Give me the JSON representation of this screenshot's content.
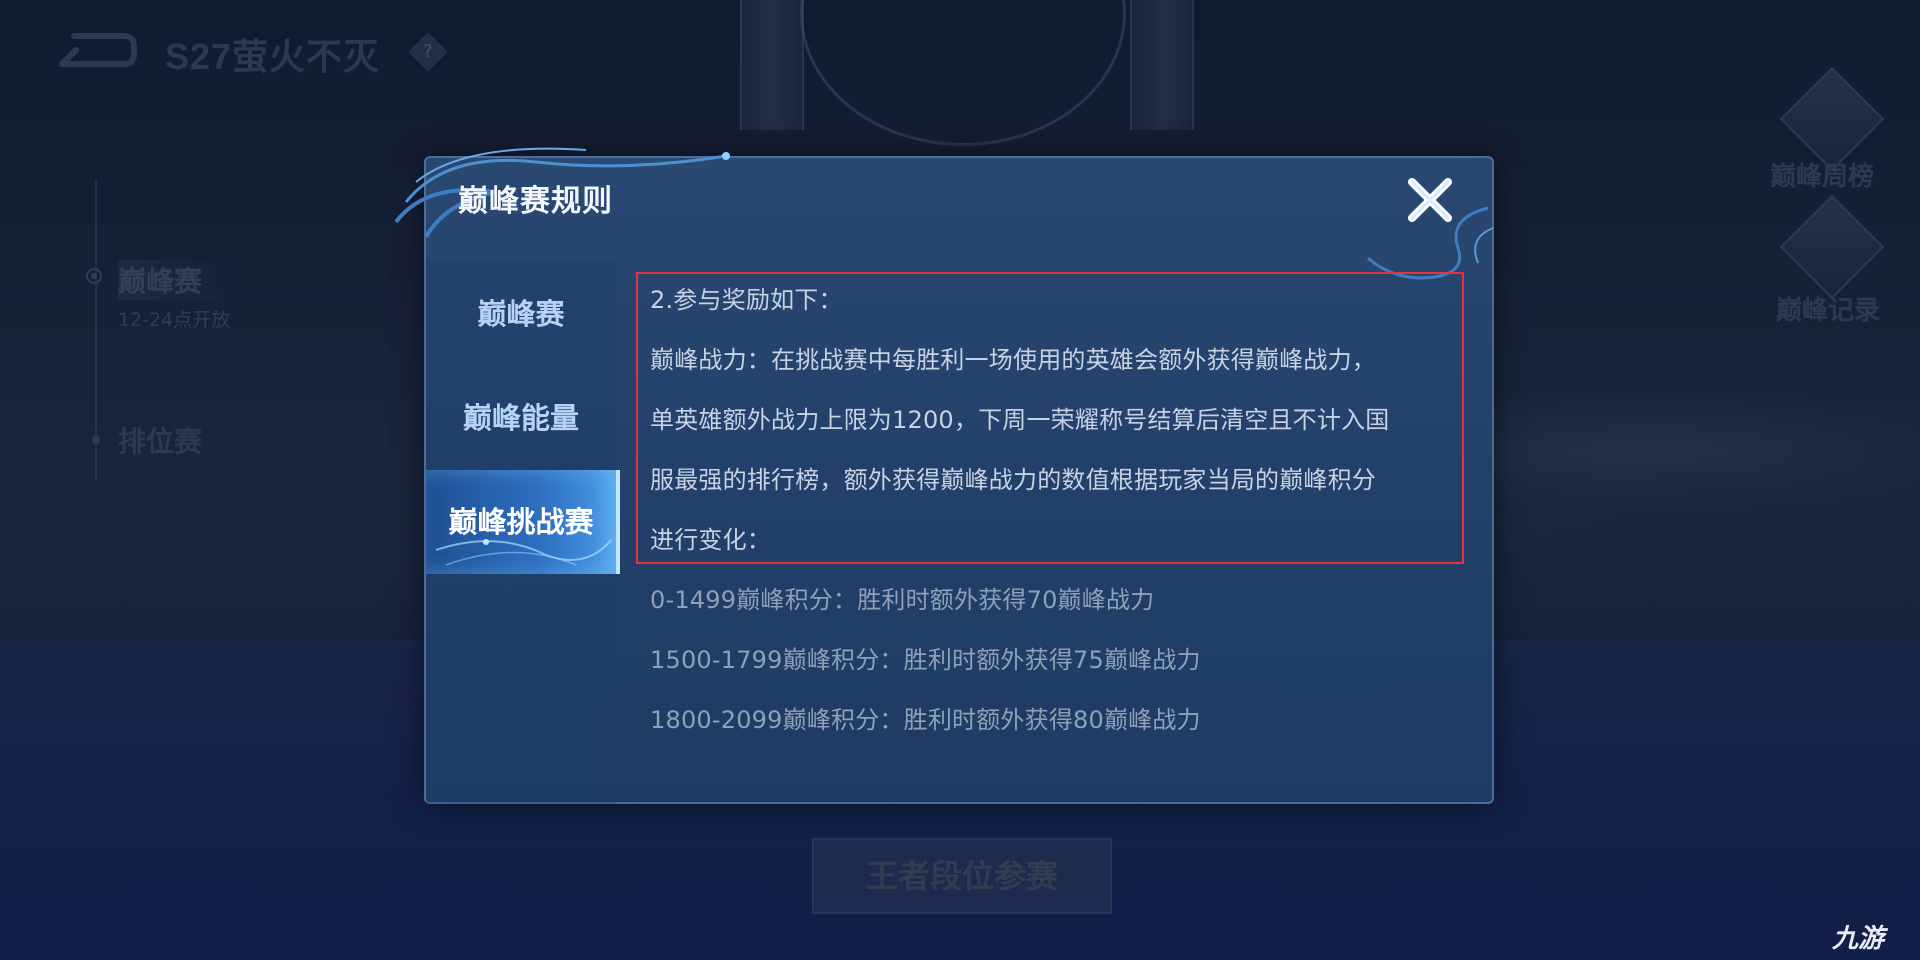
{
  "header": {
    "season_title": "S27萤火不灭",
    "help_glyph": "?"
  },
  "side_menu": {
    "peak_label": "巅峰赛",
    "peak_hours": "12-24点开放",
    "rank_label": "排位赛"
  },
  "right_menu": {
    "weekly_rank_label": "巅峰周榜",
    "record_label": "巅峰记录"
  },
  "bottom": {
    "button_label": "王者段位参赛",
    "watermark": "九游"
  },
  "dialog": {
    "title": "巅峰赛规则",
    "tabs": [
      {
        "label": "巅峰赛",
        "active": false
      },
      {
        "label": "巅峰能量",
        "active": false
      },
      {
        "label": "巅峰挑战赛",
        "active": true
      }
    ],
    "lines": [
      "2.参与奖励如下：",
      "巅峰战力：在挑战赛中每胜利一场使用的英雄会额外获得巅峰战力，",
      "单英雄额外战力上限为1200，下周一荣耀称号结算后清空且不计入国",
      "服最强的排行榜，额外获得巅峰战力的数值根据玩家当局的巅峰积分",
      "进行变化：",
      "0-1499巅峰积分：胜利时额外获得70巅峰战力",
      "1500-1799巅峰积分：胜利时额外获得75巅峰战力",
      "1800-2099巅峰积分：胜利时额外获得80巅峰战力"
    ]
  },
  "colors": {
    "highlight_border": "#e5323c",
    "active_tab": "#2e6fc0",
    "dialog_bg": "#22406a"
  }
}
